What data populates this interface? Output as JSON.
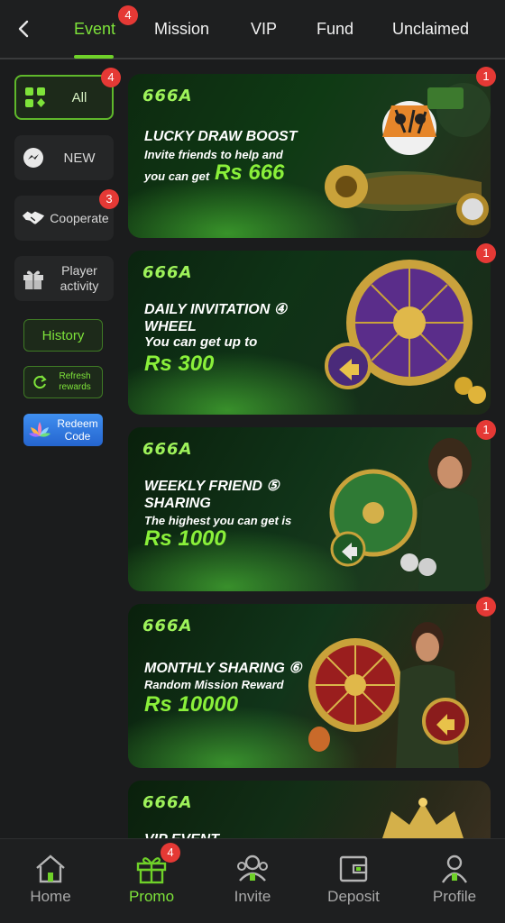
{
  "header": {
    "tabs": [
      {
        "label": "Event",
        "badge": "4"
      },
      {
        "label": "Mission"
      },
      {
        "label": "VIP"
      },
      {
        "label": "Fund"
      },
      {
        "label": "Unclaimed"
      }
    ],
    "active_tab": "Event"
  },
  "sidebar": {
    "items": [
      {
        "label": "All",
        "badge": "4",
        "icon": "grid-icon"
      },
      {
        "label": "NEW",
        "icon": "messenger-icon"
      },
      {
        "label": "Cooperate",
        "badge": "3",
        "icon": "handshake-icon"
      },
      {
        "label": "Player activity",
        "icon": "gift-icon"
      }
    ],
    "history_label": "History",
    "refresh_label": "Refresh rewards",
    "redeem_label": "Redeem Code"
  },
  "banners": [
    {
      "brand": "666A",
      "badge": "1",
      "title": "LUCKY DRAW BOOST",
      "sub": "Invite friends to help and",
      "sub2": "you can get",
      "amount": "Rs 666"
    },
    {
      "brand": "666A",
      "badge": "1",
      "title": "DAILY INVITATION ④ WHEEL",
      "sub": "You can get up to",
      "amount": "Rs 300"
    },
    {
      "brand": "666A",
      "badge": "1",
      "title": "WEEKLY FRIEND ⑤ SHARING",
      "sub": "The highest you can get is",
      "amount": "Rs 1000"
    },
    {
      "brand": "666A",
      "badge": "1",
      "title": "MONTHLY SHARING ⑥",
      "sub": "Random Mission Reward",
      "amount": "Rs 10000"
    },
    {
      "brand": "666A",
      "title": "VIP EVENT"
    }
  ],
  "bottom_nav": [
    {
      "label": "Home",
      "icon": "home-icon"
    },
    {
      "label": "Promo",
      "icon": "gift-icon",
      "badge": "4",
      "active": true
    },
    {
      "label": "Invite",
      "icon": "invite-icon"
    },
    {
      "label": "Deposit",
      "icon": "wallet-icon"
    },
    {
      "label": "Profile",
      "icon": "profile-icon"
    }
  ],
  "colors": {
    "accent": "#7ee33a",
    "badge": "#e53935",
    "background": "#1b1c1d"
  }
}
